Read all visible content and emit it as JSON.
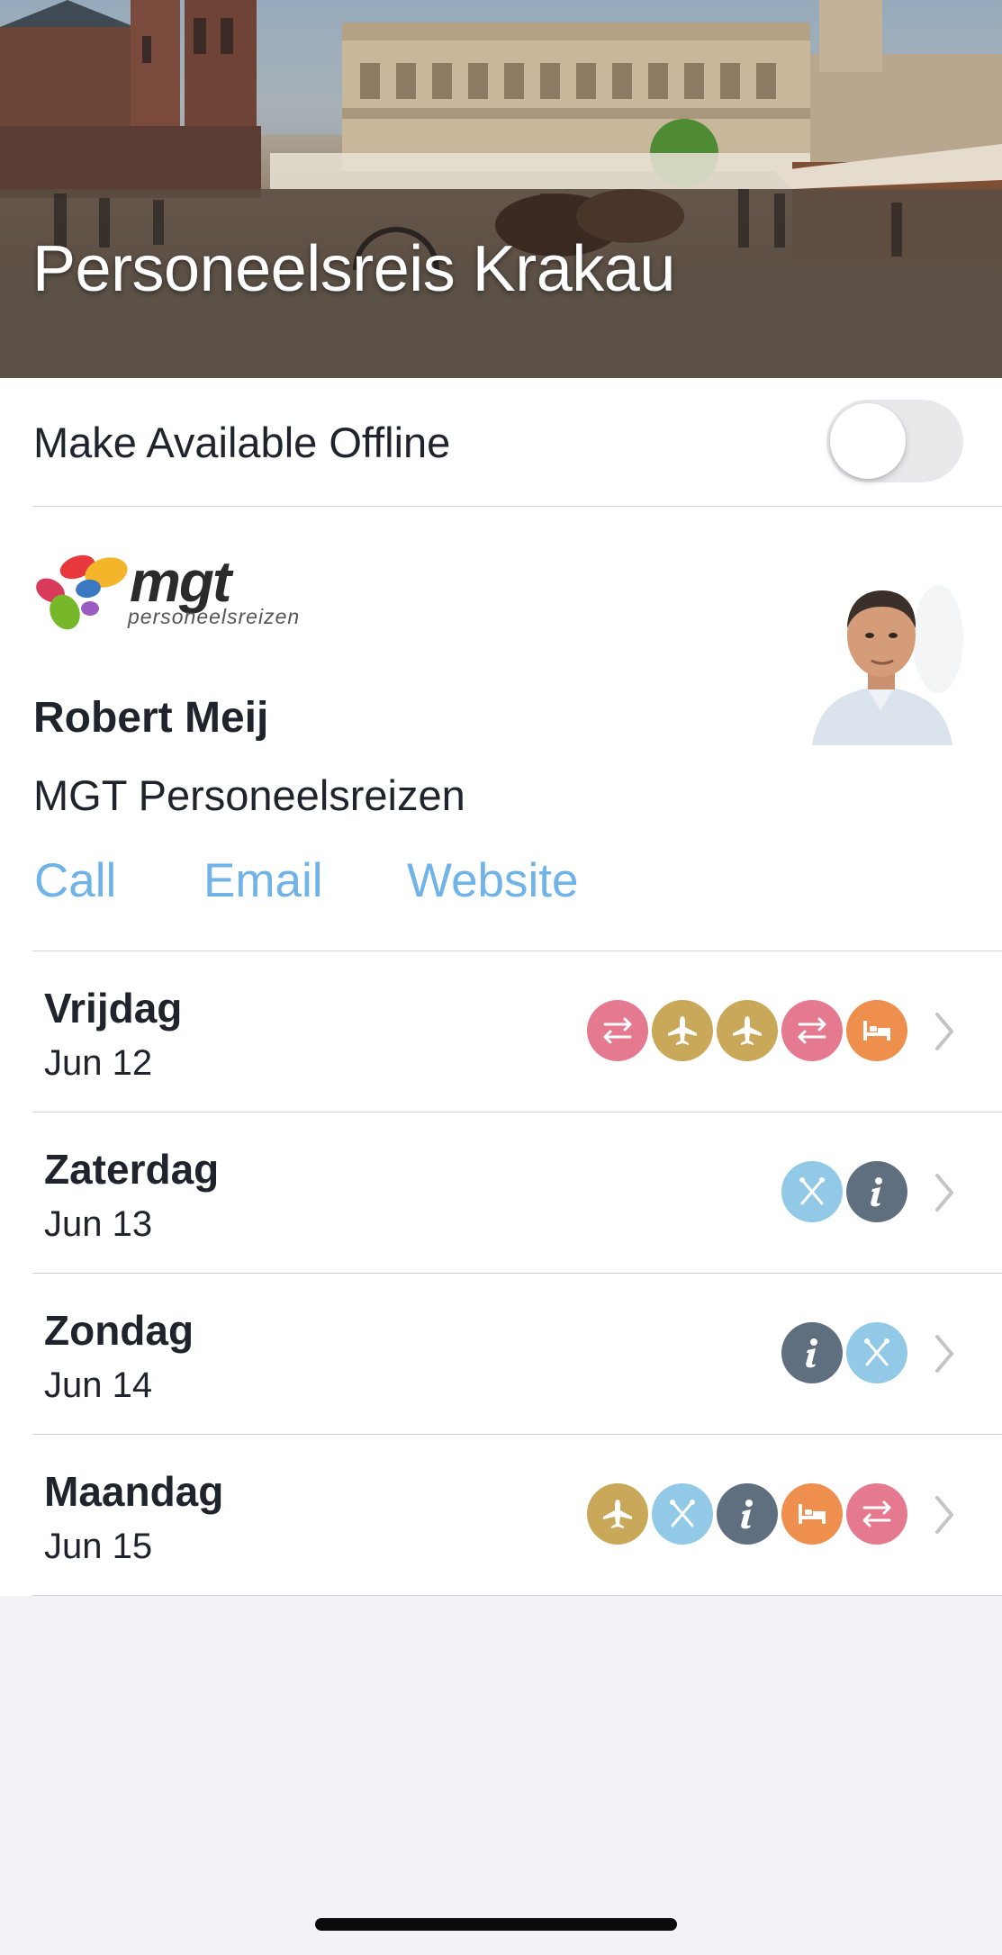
{
  "trip": {
    "title": "Personeelsreis Krakau"
  },
  "offline": {
    "label": "Make Available Offline",
    "enabled": false
  },
  "contact": {
    "logo_word": "mgt",
    "logo_subtitle": "personeelsreizen",
    "name": "Robert Meij",
    "company": "MGT Personeelsreizen",
    "actions": [
      "Call",
      "Email",
      "Website"
    ]
  },
  "days": [
    {
      "name": "Vrijdag",
      "date": "Jun 12",
      "icons": [
        "transfer",
        "flight",
        "flight",
        "transfer",
        "hotel"
      ]
    },
    {
      "name": "Zaterdag",
      "date": "Jun 13",
      "icons": [
        "restaurant",
        "info"
      ]
    },
    {
      "name": "Zondag",
      "date": "Jun 14",
      "icons": [
        "info",
        "restaurant"
      ]
    },
    {
      "name": "Maandag",
      "date": "Jun 15",
      "icons": [
        "flight",
        "restaurant",
        "info",
        "hotel",
        "transfer"
      ]
    }
  ],
  "icon_colors": {
    "transfer": "#e5798f",
    "flight": "#c9a85a",
    "hotel": "#ef8f4e",
    "restaurant": "#92c9e6",
    "info": "#5f6f7f"
  },
  "link_color": "#6fb3e8"
}
